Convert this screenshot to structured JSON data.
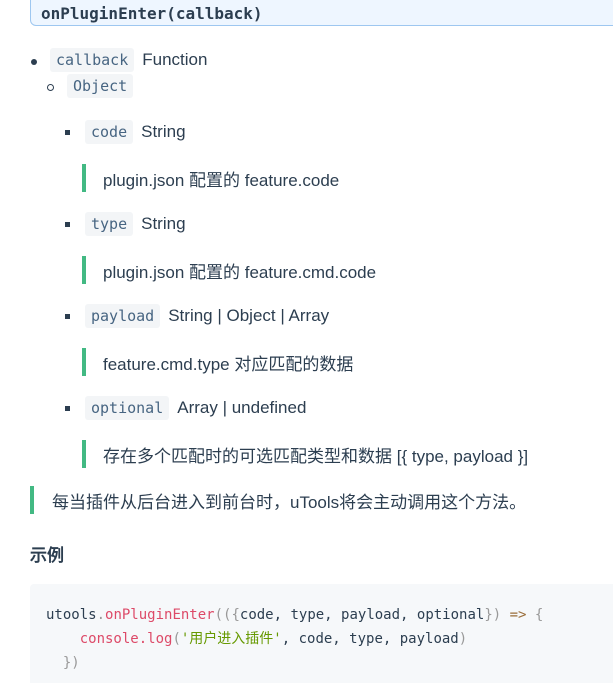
{
  "signature": "onPluginEnter(callback)",
  "params": {
    "callback": {
      "name": "callback",
      "type": "Function"
    },
    "object": {
      "name": "Object"
    },
    "fields": [
      {
        "name": "code",
        "type": "String",
        "desc": "plugin.json 配置的 feature.code"
      },
      {
        "name": "type",
        "type": "String",
        "desc": "plugin.json 配置的 feature.cmd.code"
      },
      {
        "name": "payload",
        "type": "String | Object | Array",
        "desc": "feature.cmd.type 对应匹配的数据"
      },
      {
        "name": "optional",
        "type": "Array | undefined",
        "desc": "存在多个匹配时的可选匹配类型和数据 [{ type, payload }]"
      }
    ]
  },
  "note": "每当插件从后台进入到前台时，uTools将会主动调用这个方法。",
  "example": {
    "heading": "示例",
    "line1": {
      "obj": "utools",
      "dot": ".",
      "fn": "onPluginEnter",
      "open": "((",
      "brace_open": "{",
      "args": "code, type, payload, optional",
      "brace_close": "}",
      "close": ")",
      "arrow": " => ",
      "body_open": "{"
    },
    "line2": {
      "indent": "    ",
      "fn": "console.log",
      "open": "(",
      "str": "'用户进入插件'",
      "args": ", code, type, payload",
      "close": ")"
    },
    "line3": {
      "indent": "  ",
      "text": "})"
    }
  }
}
